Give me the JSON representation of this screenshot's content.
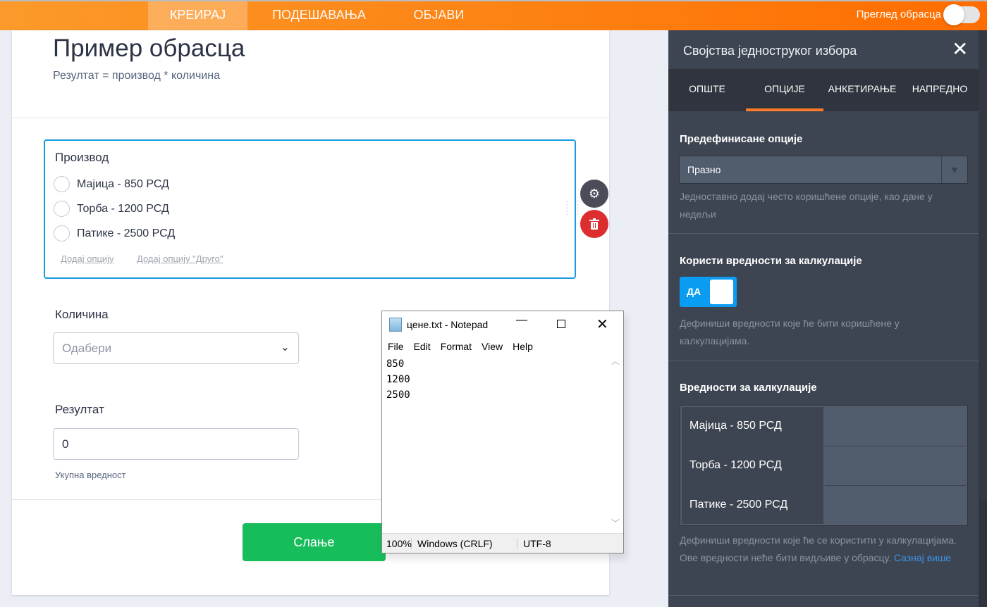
{
  "topbar": {
    "tabs": [
      "КРЕИРАЈ",
      "ПОДЕШАВАЊА",
      "ОБЈАВИ"
    ],
    "preview_label": "Преглед обрасца"
  },
  "form": {
    "title": "Пример обрасца",
    "subtitle": "Резултат = производ * количина",
    "product": {
      "label": "Производ",
      "options": [
        "Мајица - 850 РСД",
        "Торба - 1200 РСД",
        "Патике - 2500 РСД"
      ],
      "add_option": "Додај опцију",
      "add_other": "Додај опцију \"Друго\""
    },
    "quantity": {
      "label": "Количина",
      "placeholder": "Одабери"
    },
    "result": {
      "label": "Резултат",
      "value": "0",
      "sublabel": "Укупна вредност"
    },
    "submit": "Слање"
  },
  "notepad": {
    "title": "цене.txt - Notepad",
    "menu": [
      "File",
      "Edit",
      "Format",
      "View",
      "Help"
    ],
    "content": "850\n1200\n2500",
    "status": {
      "zoom": "100%",
      "eol": "Windows (CRLF)",
      "encoding": "UTF-8"
    }
  },
  "panel": {
    "title": "Својства једноструког избора",
    "tabs": [
      "ОПШТЕ",
      "ОПЦИЈЕ",
      "АНКЕТИРАЊЕ",
      "НАПРЕДНО"
    ],
    "predefined": {
      "heading": "Предефинисане опције",
      "value": "Празно",
      "desc": "Једноставно додај често коришћене опције, као дане у недељи"
    },
    "use_values": {
      "heading": "Користи вредности за калкулације",
      "toggle": "ДА",
      "desc": "Дефиниши вредности које ће бити коришћене у калкулацијама."
    },
    "calc_values": {
      "heading": "Вредности за калкулације",
      "rows": [
        "Мајица - 850 РСД",
        "Торба - 1200 РСД",
        "Патике - 2500 РСД"
      ],
      "desc": "Дефиниши вредности које ће се користити у калкулацијама. Ове вредности неће бити видљиве у обрасцу.",
      "link": "Сазнај више"
    }
  },
  "colors": {
    "accent": "#ff6d00",
    "selection": "#1a9ae5",
    "submit": "#18bd5b",
    "delete": "#dc2e2e"
  }
}
